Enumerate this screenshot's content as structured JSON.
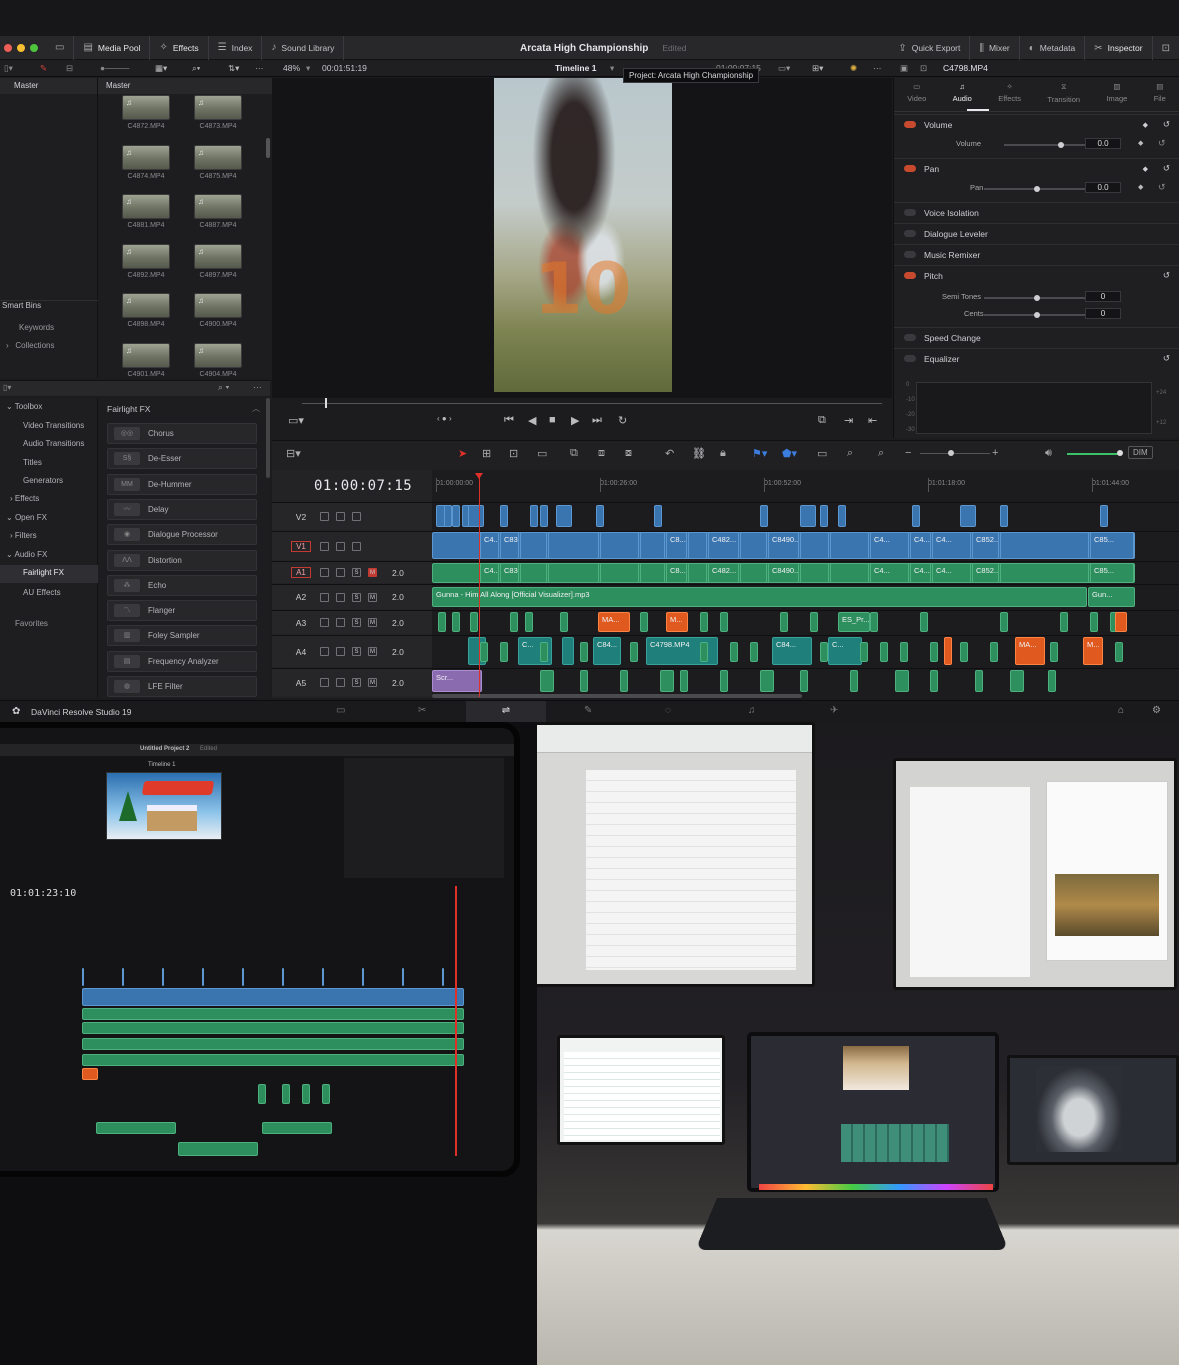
{
  "toolbar": {
    "media_pool": "Media Pool",
    "effects": "Effects",
    "index": "Index",
    "sound_library": "Sound Library",
    "project_title": "Arcata High Championship",
    "edited": "Edited",
    "quick_export": "Quick Export",
    "mixer": "Mixer",
    "metadata": "Metadata",
    "inspector": "Inspector"
  },
  "subbar": {
    "zoom": "48%",
    "timecode": "00:01:51:19",
    "timeline_name": "Timeline 1",
    "tooltip": "Project: Arcata High Championship",
    "tooltip_timecode": "01:00:07:15",
    "clip_name": "C4798.MP4"
  },
  "bins": {
    "master_left": "Master",
    "master_right": "Master",
    "smart_bins": "Smart Bins",
    "keywords": "Keywords",
    "collections": "Collections"
  },
  "media": [
    {
      "name": "C4872.MP4"
    },
    {
      "name": "C4873.MP4"
    },
    {
      "name": "C4874.MP4"
    },
    {
      "name": "C4875.MP4"
    },
    {
      "name": "C4881.MP4"
    },
    {
      "name": "C4887.MP4"
    },
    {
      "name": "C4892.MP4"
    },
    {
      "name": "C4897.MP4"
    },
    {
      "name": "C4898.MP4"
    },
    {
      "name": "C4900.MP4"
    },
    {
      "name": "C4901.MP4"
    },
    {
      "name": "C4904.MP4"
    }
  ],
  "inspector": {
    "tabs": [
      "Video",
      "Audio",
      "Effects",
      "Transition",
      "Image",
      "File"
    ],
    "active_tab": "Audio",
    "volume_section": "Volume",
    "volume_label": "Volume",
    "volume_value": "0.0",
    "pan_section": "Pan",
    "pan_label": "Pan",
    "pan_value": "0.0",
    "voice_isolation": "Voice Isolation",
    "dialogue_leveler": "Dialogue Leveler",
    "music_remixer": "Music Remixer",
    "pitch": "Pitch",
    "semi_tones": "Semi Tones",
    "semi_tones_value": "0",
    "cents": "Cents",
    "cents_value": "0",
    "speed_change": "Speed Change",
    "equalizer": "Equalizer",
    "eq_ticks": [
      "0",
      "-10",
      "-20",
      "-30",
      "+24",
      "+12"
    ]
  },
  "effects_panel": {
    "toolbox": "Toolbox",
    "video_transitions": "Video Transitions",
    "audio_transitions": "Audio Transitions",
    "titles": "Titles",
    "generators": "Generators",
    "effects": "Effects",
    "open_fx": "Open FX",
    "filters": "Filters",
    "audio_fx": "Audio FX",
    "fairlight_fx": "Fairlight FX",
    "au_effects": "AU Effects",
    "favorites": "Favorites",
    "header": "Fairlight FX",
    "items": [
      "Chorus",
      "De-Esser",
      "De-Hummer",
      "Delay",
      "Dialogue Processor",
      "Distortion",
      "Echo",
      "Flanger",
      "Foley Sampler",
      "Frequency Analyzer",
      "LFE Filter"
    ]
  },
  "timeline": {
    "timecode": "01:00:07:15",
    "ruler": [
      "01:00:00:00",
      "01:00:26:00",
      "01:00:52:00",
      "01:01:18:00",
      "01:01:44:00"
    ],
    "dim": "DIM",
    "tracks": [
      {
        "name": "V2",
        "level": ""
      },
      {
        "name": "V1",
        "level": ""
      },
      {
        "name": "A1",
        "level": "2.0"
      },
      {
        "name": "A2",
        "level": "2.0"
      },
      {
        "name": "A3",
        "level": "2.0"
      },
      {
        "name": "A4",
        "level": "2.0"
      },
      {
        "name": "A5",
        "level": "2.0"
      }
    ],
    "v1_labels": [
      "C4...",
      "C835...",
      "C8...",
      "C482...",
      "C8490...",
      "C4...",
      "C4...",
      "C4...",
      "C852...",
      "C85..."
    ],
    "a1_labels": [
      "C4...",
      "C835...",
      "C8...",
      "C482...",
      "C8490...",
      "C4...",
      "C4...",
      "C4...",
      "C852...",
      "C85..."
    ],
    "a2_main": "Gunna - Him All Along [Official Visualizer].mp3",
    "a2_end": "Gun...",
    "a3_labels": [
      "MA...",
      "M...",
      "ES_Pr..."
    ],
    "a4_labels": [
      "C...",
      "C84...",
      "C4798.MP4",
      "C84...",
      "C...",
      "MA...",
      "M..."
    ],
    "a5_label": "Scr..."
  },
  "footer": {
    "app_name": "DaVinci Resolve Studio 19"
  },
  "photo_left": {
    "project": "Untitled Project 2",
    "edited": "Edited",
    "timeline": "Timeline 1",
    "timecode": "01:01:23:10"
  },
  "colors": {
    "accent_red": "#c23b33",
    "video_clip": "#3b75b0",
    "audio_clip": "#2d8f5e",
    "music_clip": "#1f7f7a",
    "sfx_clip": "#e05a1f"
  }
}
